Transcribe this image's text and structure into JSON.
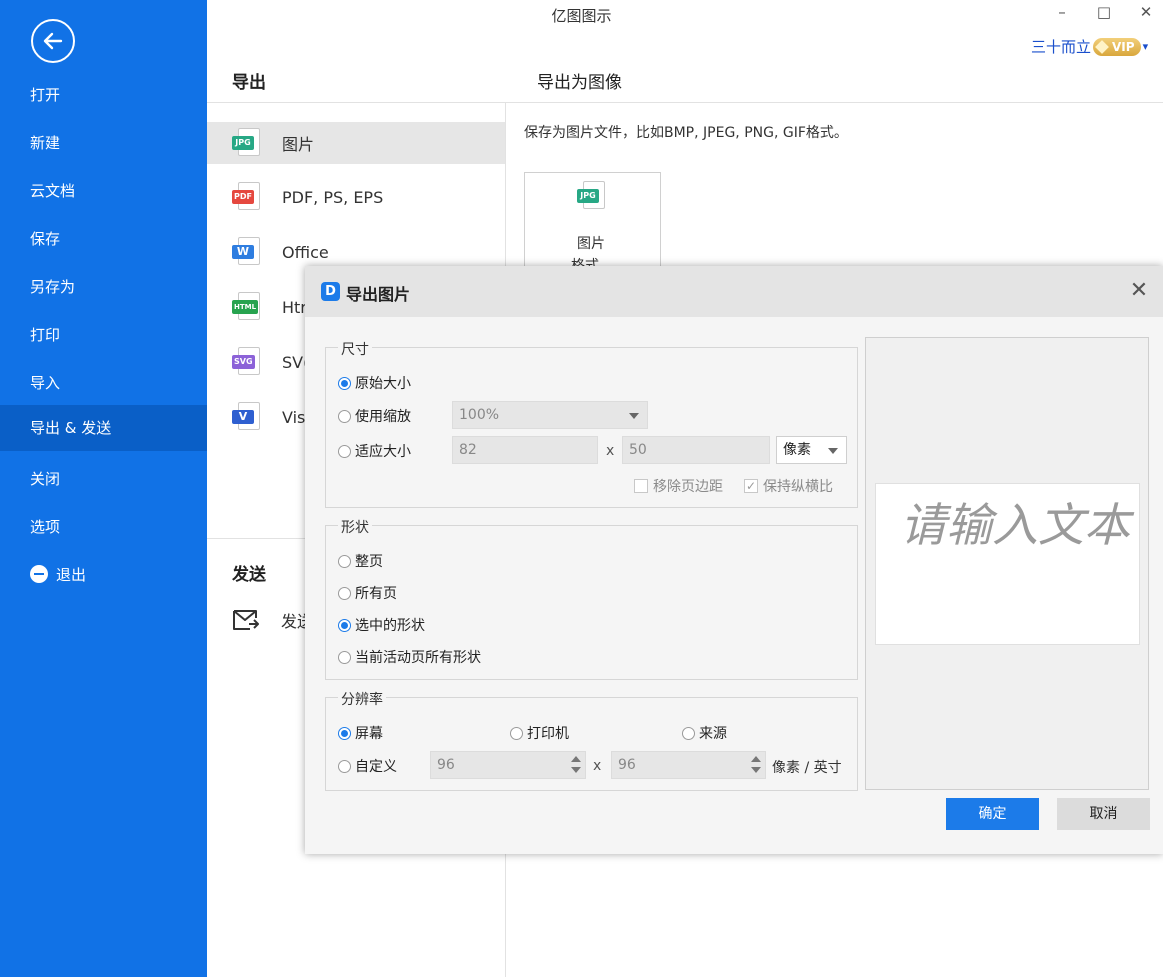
{
  "app": {
    "title": "亿图图示"
  },
  "window": {
    "minimize": "–",
    "maximize": "□",
    "close": "✕"
  },
  "user": {
    "name": "三十而立",
    "badge": "VIP",
    "arrow": "▾"
  },
  "sidebar": {
    "items": [
      {
        "label": "打开"
      },
      {
        "label": "新建"
      },
      {
        "label": "云文档"
      },
      {
        "label": "保存"
      },
      {
        "label": "另存为"
      },
      {
        "label": "打印"
      },
      {
        "label": "导入"
      },
      {
        "label": "导出 & 发送",
        "active": true
      },
      {
        "label": "关闭"
      },
      {
        "label": "选项"
      },
      {
        "label": "退出"
      }
    ]
  },
  "export_panel": {
    "header": "导出",
    "formats": [
      {
        "label": "图片",
        "tag": "JPG",
        "color": "#27a885",
        "active": true
      },
      {
        "label": "PDF, PS, EPS",
        "tag": "PDF",
        "color": "#e5483f"
      },
      {
        "label": "Office",
        "tag": "W",
        "color": "#2e7de0"
      },
      {
        "label": "Htr",
        "tag": "HTML",
        "color": "#27a34f"
      },
      {
        "label": "SV(",
        "tag": "SVG",
        "color": "#8c62d8"
      },
      {
        "label": "Vis",
        "tag": "V",
        "color": "#2e5fd0"
      }
    ],
    "send_header": "发送",
    "send_item": "发送"
  },
  "right_panel": {
    "header": "导出为图像",
    "description": "保存为图片文件，比如BMP, JPEG, PNG, GIF格式。",
    "card": {
      "tag": "JPG",
      "title": "图片",
      "subtitle": "格式"
    }
  },
  "dialog": {
    "title": "导出图片",
    "logo": "D",
    "close": "✕",
    "size": {
      "label": "尺寸",
      "original": "原始大小",
      "scale": "使用缩放",
      "scale_value": "100%",
      "fit": "适应大小",
      "width": "82",
      "height": "50",
      "x": "x",
      "unit": "像素",
      "remove_margin": "移除页边距",
      "keep_ratio": "保持纵横比",
      "selected": "original"
    },
    "shape": {
      "label": "形状",
      "options": [
        "整页",
        "所有页",
        "选中的形状",
        "当前活动页所有形状"
      ],
      "selected_index": 2
    },
    "resolution": {
      "label": "分辨率",
      "screen": "屏幕",
      "printer": "打印机",
      "source": "来源",
      "custom": "自定义",
      "dpi_x": "96",
      "dpi_y": "96",
      "x": "x",
      "unit": "像素 / 英寸",
      "selected": "screen"
    },
    "preview_text": "请输入文本",
    "ok": "确定",
    "cancel": "取消"
  }
}
